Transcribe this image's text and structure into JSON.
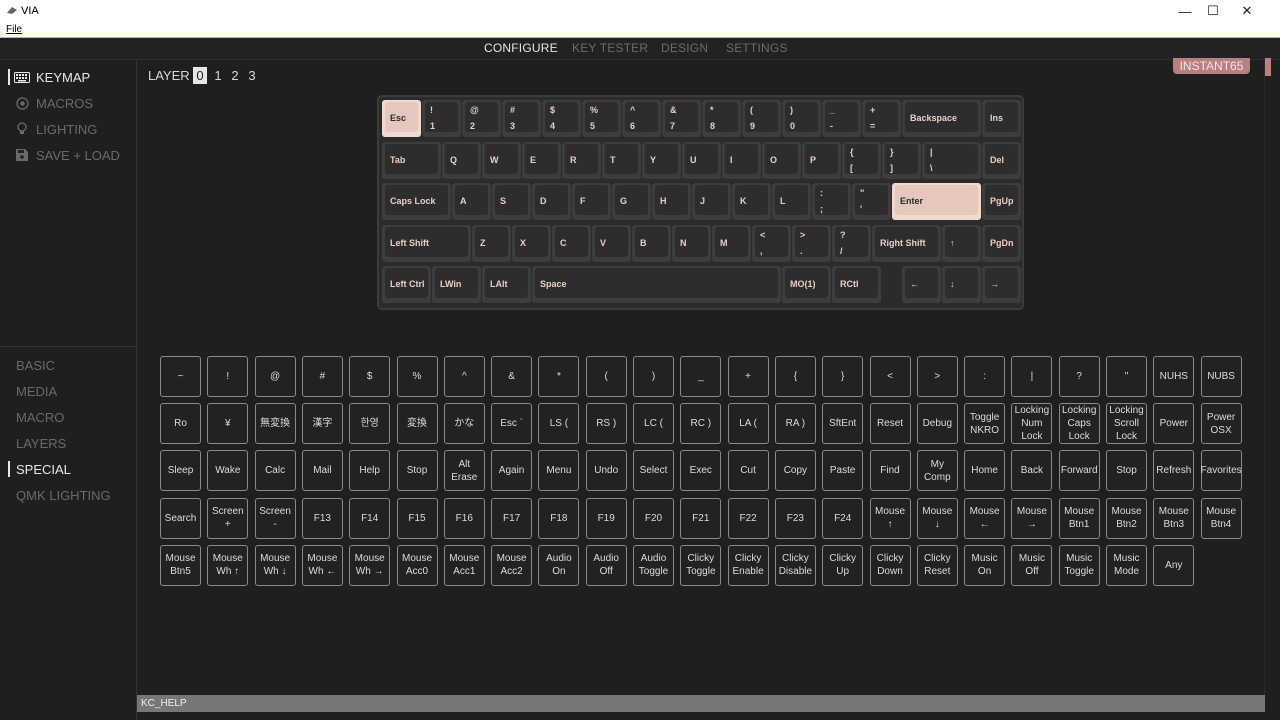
{
  "window": {
    "title": "VIA",
    "menu": [
      "File"
    ],
    "min_icon": "minimize-icon",
    "max_icon": "maximize-icon",
    "close_icon": "close-icon"
  },
  "nav": {
    "tabs": [
      "CONFIGURE",
      "KEY TESTER",
      "DESIGN",
      "SETTINGS"
    ],
    "active": "CONFIGURE"
  },
  "sidebar": {
    "items": [
      {
        "label": "KEYMAP",
        "icon": "keyboard-icon",
        "active": true
      },
      {
        "label": "MACROS",
        "icon": "macro-record-icon",
        "active": false
      },
      {
        "label": "LIGHTING",
        "icon": "lightbulb-icon",
        "active": false
      },
      {
        "label": "SAVE + LOAD",
        "icon": "floppy-disk-icon",
        "active": false
      }
    ]
  },
  "layers": {
    "label": "LAYER",
    "values": [
      "0",
      "1",
      "2",
      "3"
    ],
    "active": "0"
  },
  "device": {
    "name": "INSTANT65"
  },
  "keyboard": {
    "rows": [
      [
        [
          "Esc",
          ""
        ],
        [
          "!",
          "1"
        ],
        [
          "@",
          "2"
        ],
        [
          "#",
          "3"
        ],
        [
          "$",
          "4"
        ],
        [
          "%",
          "5"
        ],
        [
          "^",
          "6"
        ],
        [
          "&",
          "7"
        ],
        [
          "*",
          "8"
        ],
        [
          "(",
          "9"
        ],
        [
          ")",
          "0"
        ],
        [
          "_",
          "-"
        ],
        [
          "+",
          "="
        ],
        [
          "Backspace",
          ""
        ],
        [
          "Ins",
          ""
        ]
      ],
      [
        [
          "Tab",
          ""
        ],
        [
          "Q",
          ""
        ],
        [
          "W",
          ""
        ],
        [
          "E",
          ""
        ],
        [
          "R",
          ""
        ],
        [
          "T",
          ""
        ],
        [
          "Y",
          ""
        ],
        [
          "U",
          ""
        ],
        [
          "I",
          ""
        ],
        [
          "O",
          ""
        ],
        [
          "P",
          ""
        ],
        [
          "{",
          "["
        ],
        [
          "}",
          "]"
        ],
        [
          "|",
          "\\"
        ],
        [
          "Del",
          ""
        ]
      ],
      [
        [
          "Caps Lock",
          ""
        ],
        [
          "A",
          ""
        ],
        [
          "S",
          ""
        ],
        [
          "D",
          ""
        ],
        [
          "F",
          ""
        ],
        [
          "G",
          ""
        ],
        [
          "H",
          ""
        ],
        [
          "J",
          ""
        ],
        [
          "K",
          ""
        ],
        [
          "L",
          ""
        ],
        [
          ":",
          ";"
        ],
        [
          "\"",
          "'"
        ],
        [
          "Enter",
          ""
        ],
        [
          "PgUp",
          ""
        ]
      ],
      [
        [
          "Left Shift",
          ""
        ],
        [
          "Z",
          ""
        ],
        [
          "X",
          ""
        ],
        [
          "C",
          ""
        ],
        [
          "V",
          ""
        ],
        [
          "B",
          ""
        ],
        [
          "N",
          ""
        ],
        [
          "M",
          ""
        ],
        [
          "<",
          ","
        ],
        [
          ">",
          "."
        ],
        [
          "?",
          "/"
        ],
        [
          "Right Shift",
          ""
        ],
        [
          "↑",
          ""
        ],
        [
          "PgDn",
          ""
        ]
      ],
      [
        [
          "Left Ctrl",
          ""
        ],
        [
          "LWin",
          ""
        ],
        [
          "LAlt",
          ""
        ],
        [
          "Space",
          ""
        ],
        [
          "MO(1)",
          ""
        ],
        [
          "RCtl",
          ""
        ],
        [
          "←",
          ""
        ],
        [
          "↓",
          ""
        ],
        [
          "→",
          ""
        ]
      ]
    ]
  },
  "categories": {
    "items": [
      "BASIC",
      "MEDIA",
      "MACRO",
      "LAYERS",
      "SPECIAL",
      "QMK LIGHTING"
    ],
    "active": "SPECIAL"
  },
  "palette": {
    "keys": [
      "~",
      "!",
      "@",
      "#",
      "$",
      "%",
      "^",
      "&",
      "*",
      "(",
      ")",
      "_",
      "+",
      "{",
      "}",
      "<",
      ">",
      ":",
      "|",
      "?",
      "\"",
      "NUHS",
      "NUBS",
      "Ro",
      "¥",
      "無変換",
      "漢字",
      "한영",
      "変換",
      "かな",
      "Esc `",
      "LS (",
      "RS )",
      "LC (",
      "RC )",
      "LA (",
      "RA )",
      "SftEnt",
      "Reset",
      "Debug",
      "Toggle NKRO",
      "Locking Num Lock",
      "Locking Caps Lock",
      "Locking Scroll Lock",
      "Power",
      "Power OSX",
      "Sleep",
      "Wake",
      "Calc",
      "Mail",
      "Help",
      "Stop",
      "Alt Erase",
      "Again",
      "Menu",
      "Undo",
      "Select",
      "Exec",
      "Cut",
      "Copy",
      "Paste",
      "Find",
      "My Comp",
      "Home",
      "Back",
      "Forward",
      "Stop",
      "Refresh",
      "Favorites",
      "Search",
      "Screen +",
      "Screen -",
      "F13",
      "F14",
      "F15",
      "F16",
      "F17",
      "F18",
      "F19",
      "F20",
      "F21",
      "F22",
      "F23",
      "F24",
      "Mouse ↑",
      "Mouse ↓",
      "Mouse ←",
      "Mouse →",
      "Mouse Btn1",
      "Mouse Btn2",
      "Mouse Btn3",
      "Mouse Btn4",
      "Mouse Btn5",
      "Mouse Wh ↑",
      "Mouse Wh ↓",
      "Mouse Wh ←",
      "Mouse Wh →",
      "Mouse Acc0",
      "Mouse Acc1",
      "Mouse Acc2",
      "Audio On",
      "Audio Off",
      "Audio Toggle",
      "Clicky Toggle",
      "Clicky Enable",
      "Clicky Disable",
      "Clicky Up",
      "Clicky Down",
      "Clicky Reset",
      "Music On",
      "Music Off",
      "Music Toggle",
      "Music Mode",
      "Any"
    ],
    "selected_index": 114
  },
  "status": {
    "text": "KC_HELP"
  },
  "colors": {
    "accent": "#b9807f",
    "selected_key": "#c48a8a",
    "legend": "#e9cfc4"
  }
}
